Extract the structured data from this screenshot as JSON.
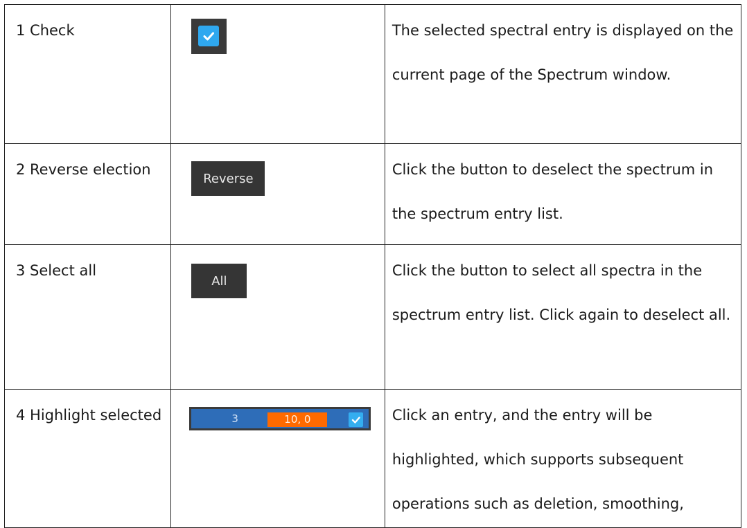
{
  "rows": [
    {
      "name": "1 Check",
      "description": "The selected spectral entry is displayed on the current page of the Spectrum window.",
      "icon": "checkbox-icon"
    },
    {
      "name": "2 Reverse election",
      "button_label": "Reverse",
      "description": "Click the button to deselect the spectrum in the spectrum entry list."
    },
    {
      "name": "3 Select all",
      "button_label": "All",
      "description": "Click the button to select all spectra in the spectrum entry list. Click again to deselect all."
    },
    {
      "name": "4 Highlight selected",
      "entry_index": "3",
      "entry_value": "10, 0",
      "description": "Click an entry, and the entry will be highlighted, which supports subsequent operations such as deletion, smoothing,"
    }
  ],
  "colors": {
    "checkbox_blue": "#2fa8ef",
    "button_dark": "#353535",
    "highlight_blue": "#2e6db8",
    "value_orange": "#ff6a00"
  }
}
